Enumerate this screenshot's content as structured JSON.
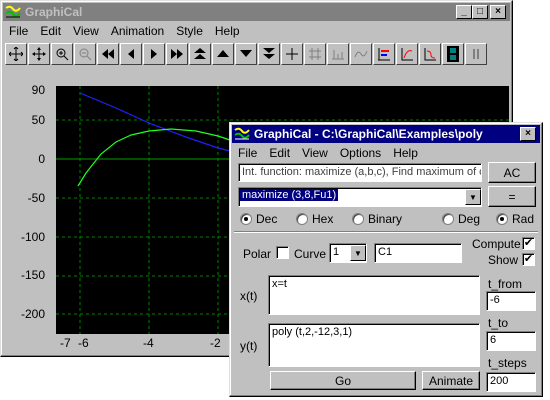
{
  "main_window": {
    "title": "GraphiCal",
    "menu": [
      "File",
      "Edit",
      "View",
      "Animation",
      "Style",
      "Help"
    ],
    "toolbar_icons": [
      "move-icon",
      "move-all-icon",
      "zoom-in-icon",
      "zoom-out-icon",
      "rewind-icon",
      "step-back-icon",
      "play-icon",
      "fast-forward-icon",
      "scroll-top-icon",
      "scroll-up-icon",
      "scroll-down-icon",
      "scroll-bottom-icon",
      "crosshair-icon",
      "grid-icon",
      "axes-icon",
      "curve-icon",
      "bar-icon",
      "colors-icon",
      "paint-icon",
      "film-icon",
      "pause-icon"
    ],
    "plot": {
      "y_ticks": [
        "90",
        "50",
        "0",
        "-50",
        "-100",
        "-150",
        "-200"
      ],
      "x_ticks": [
        "-7",
        "-6",
        "-4",
        "-2"
      ]
    },
    "controls": {
      "minimize": "_",
      "maximize": "□",
      "close": "×"
    }
  },
  "dialog": {
    "title": "GraphiCal - C:\\GraphiCal\\Examples\\poly",
    "menu": [
      "File",
      "Edit",
      "View",
      "Options",
      "Help"
    ],
    "info_text": "Int. function: maximize (a,b,c), Find maximum of c(",
    "ac_button": "AC",
    "expression": "maximize (3,8,Fu1)",
    "equals_button": "=",
    "number_modes": [
      "Dec",
      "Hex",
      "Binary"
    ],
    "number_mode_selected": "Dec",
    "angle_modes": [
      "Deg",
      "Rad"
    ],
    "angle_mode_selected": "Rad",
    "polar_label": "Polar",
    "curve_label": "Curve",
    "curve_number": "1",
    "curve_name": "C1",
    "compute_label": "Compute",
    "show_label": "Show",
    "x_label": "x(t)",
    "x_value": "x=t",
    "y_label": "y(t)",
    "y_value": "poly (t,2,-12,3,1)",
    "t_from_label": "t_from",
    "t_from_value": "-6",
    "t_to_label": "t_to",
    "t_to_value": "6",
    "t_steps_label": "t_steps",
    "t_steps_value": "200",
    "go_button": "Go",
    "animate_button": "Animate",
    "close_button": "×"
  },
  "colors": {
    "plot_bg": "#000000",
    "grid": "#008000",
    "curve_blue": "#2020ff",
    "curve_green": "#20ff20",
    "title_active": "#000080"
  }
}
